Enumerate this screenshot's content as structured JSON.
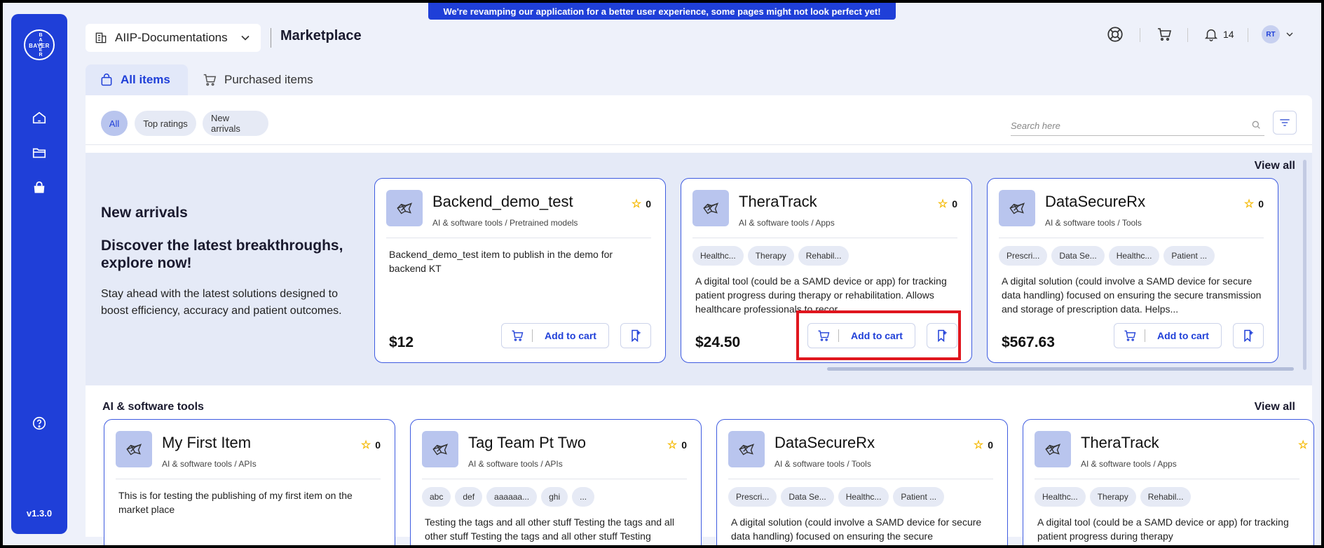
{
  "banner": "We're revamping our application for a better user experience, some pages might not look perfect yet!",
  "sidebar": {
    "logo_vertical": "BAYER",
    "logo_horizontal": "BAYER",
    "version": "v1.3.0",
    "icons": [
      "home-icon",
      "folder-icon",
      "shopping-bag-icon",
      "help-icon"
    ]
  },
  "header": {
    "workspace": "AIIP-Documentations",
    "title": "Marketplace",
    "notifications": "14",
    "avatar": "RT"
  },
  "tabs": [
    {
      "label": "All items"
    },
    {
      "label": "Purchased items"
    }
  ],
  "filters": [
    {
      "label": "All"
    },
    {
      "label": "Top ratings"
    },
    {
      "label": "New arrivals"
    }
  ],
  "search": {
    "placeholder": "Search here"
  },
  "new_arrivals": {
    "title": "New arrivals",
    "headline": "Discover the latest breakthroughs, explore now!",
    "description": "Stay ahead with the latest solutions designed to boost efficiency, accuracy and patient outcomes.",
    "view_all": "View all",
    "cards": [
      {
        "name": "Backend_demo_test",
        "category": "AI & software tools / Pretrained models",
        "rating": "0",
        "tags": [],
        "description": "Backend_demo_test item to publish in the demo for backend KT",
        "price": "$12",
        "cart_label": "Add to cart"
      },
      {
        "name": "TheraTrack",
        "category": "AI & software tools / Apps",
        "rating": "0",
        "tags": [
          "Healthc...",
          "Therapy",
          "Rehabil..."
        ],
        "description": "A digital tool (could be a SAMD device or app) for tracking patient progress during therapy or rehabilitation. Allows healthcare professionals to recor...",
        "price": "$24.50",
        "cart_label": "Add to cart"
      },
      {
        "name": "DataSecureRx",
        "category": "AI & software tools / Tools",
        "rating": "0",
        "tags": [
          "Prescri...",
          "Data Se...",
          "Healthc...",
          "Patient ..."
        ],
        "description": "A digital solution (could involve a SAMD device for secure data handling) focused on ensuring the secure transmission and storage of prescription data. Helps...",
        "price": "$567.63",
        "cart_label": "Add to cart"
      }
    ]
  },
  "ai_tools": {
    "title": "AI & software tools",
    "view_all": "View all",
    "cards": [
      {
        "name": "My First Item",
        "category": "AI & software tools / APIs",
        "rating": "0",
        "tags": [],
        "description": "This is for testing the publishing of my first item on the market place"
      },
      {
        "name": "Tag Team Pt Two",
        "category": "AI & software tools / APIs",
        "rating": "0",
        "tags": [
          "abc",
          "def",
          "aaaaaa...",
          "ghi",
          "..."
        ],
        "description": "Testing the tags and all other stuff Testing the tags and all other stuff Testing the tags and all other stuff Testing"
      },
      {
        "name": "DataSecureRx",
        "category": "AI & software tools / Tools",
        "rating": "0",
        "tags": [
          "Prescri...",
          "Data Se...",
          "Healthc...",
          "Patient ..."
        ],
        "description": "A digital solution (could involve a SAMD device for secure data handling) focused on ensuring the secure"
      },
      {
        "name": "TheraTrack",
        "category": "AI & software tools / Apps",
        "rating": "",
        "tags": [
          "Healthc...",
          "Therapy",
          "Rehabil..."
        ],
        "description": "A digital tool (could be a SAMD device or app) for tracking patient progress during therapy"
      }
    ]
  },
  "colors": {
    "brand": "#1f3fd8",
    "accent_light": "#b9c5ee",
    "highlight": "#e0161e",
    "star": "#f5b800"
  }
}
